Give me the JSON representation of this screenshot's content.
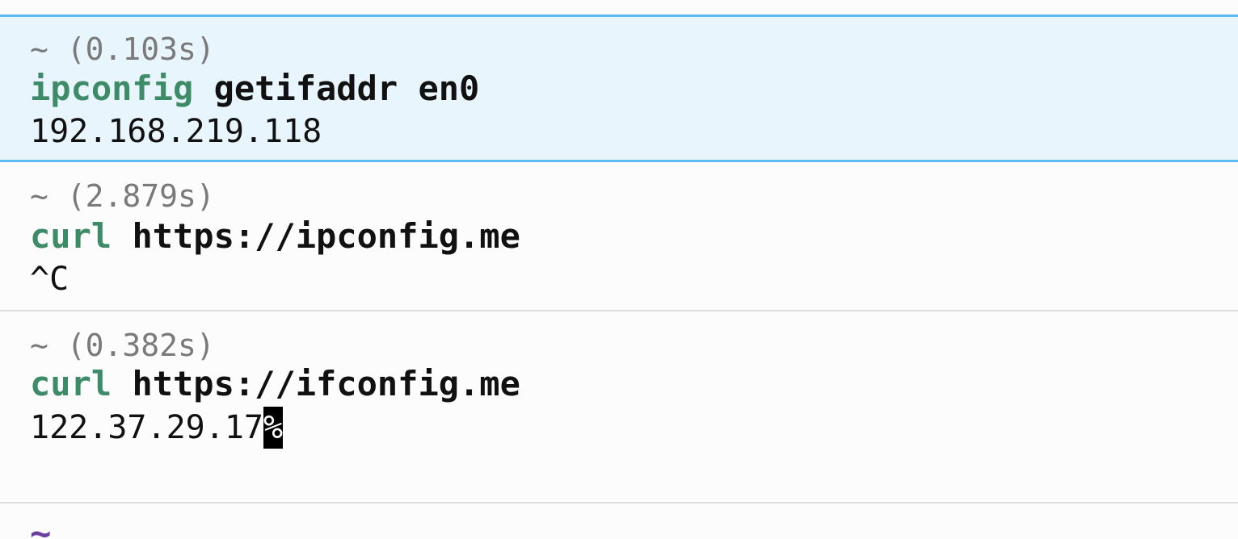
{
  "blocks": [
    {
      "meta": "~ (0.103s)",
      "command_prog": "ipconfig",
      "command_args": " getifaddr en0",
      "output": "192.168.219.118",
      "selected": true
    },
    {
      "meta": "~ (2.879s)",
      "command_prog": "curl",
      "command_args": " https://ipconfig.me",
      "output": "^C",
      "selected": false
    },
    {
      "meta": "~ (0.382s)",
      "command_prog": "curl",
      "command_args": " https://ifconfig.me",
      "output": "122.37.29.17",
      "output_suffix": "%",
      "selected": false
    }
  ],
  "prompt": {
    "symbol": "~"
  },
  "colors": {
    "selected_bg": "#e8f5fd",
    "selected_border": "#5bbaf0",
    "command_prog": "#3e8b68",
    "meta_text": "#7a7a7a",
    "prompt": "#6b3fa0"
  }
}
